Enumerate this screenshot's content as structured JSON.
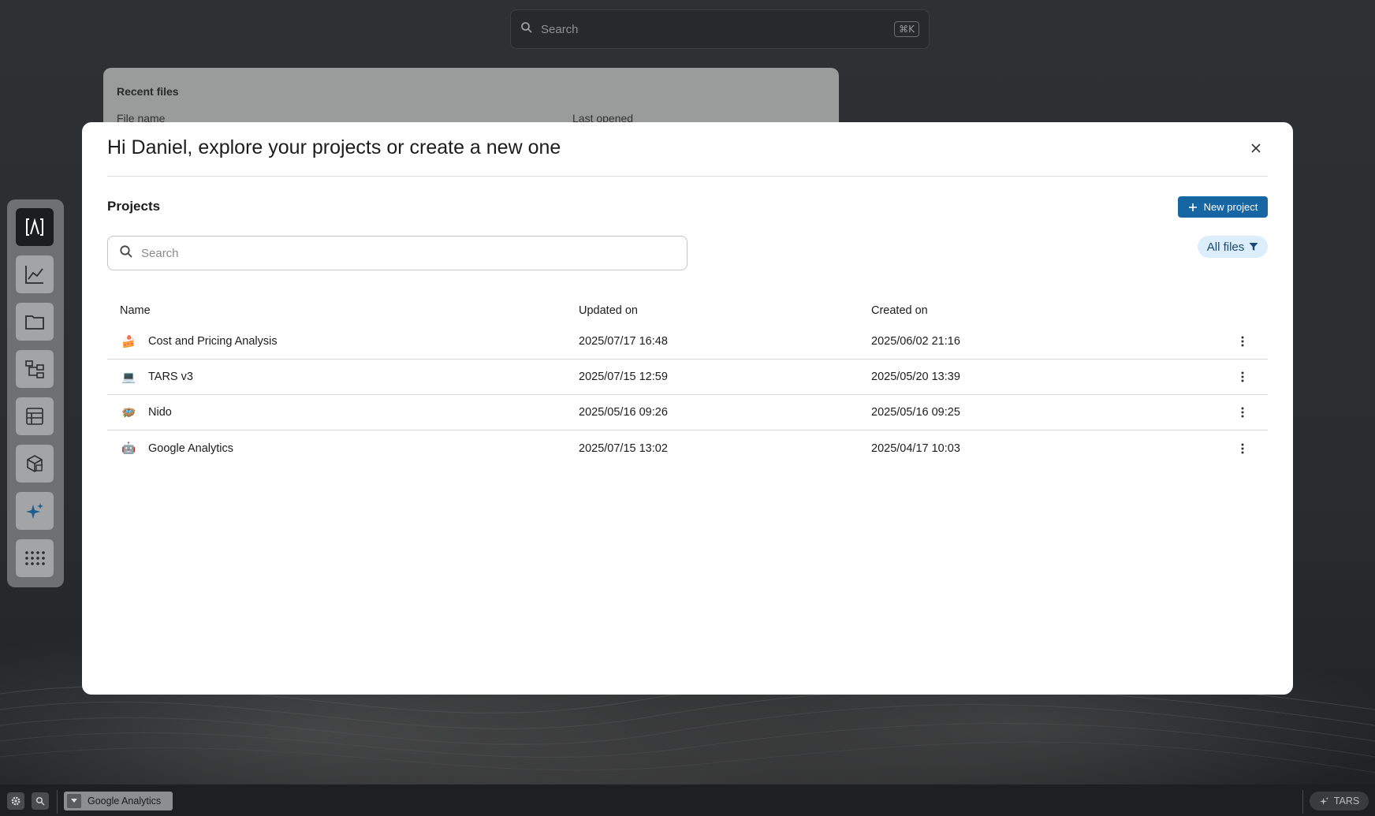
{
  "top_search": {
    "placeholder": "Search",
    "shortcut": "⌘K"
  },
  "recent_files": {
    "title": "Recent files",
    "columns": [
      "File name",
      "Last opened"
    ]
  },
  "dock": {
    "items": [
      "logo-icon",
      "analytics-icon",
      "folder-icon",
      "diagram-icon",
      "table-icon",
      "package-icon",
      "ai-sparkle-icon",
      "apps-grid-icon"
    ]
  },
  "modal": {
    "title": "Hi Daniel, explore your projects or create a new one",
    "section_title": "Projects",
    "new_project_label": "New project",
    "filter_label": "All files",
    "search_placeholder": "Search",
    "columns": {
      "name": "Name",
      "updated": "Updated on",
      "created": "Created on"
    },
    "projects": [
      {
        "icon": "🍰",
        "name": "Cost and Pricing Analysis",
        "updated": "2025/07/17 16:48",
        "created": "2025/06/02 21:16"
      },
      {
        "icon": "💻",
        "name": "TARS v3",
        "updated": "2025/07/15 12:59",
        "created": "2025/05/20 13:39"
      },
      {
        "icon": "🪺",
        "name": "Nido",
        "updated": "2025/05/16 09:26",
        "created": "2025/05/16 09:25"
      },
      {
        "icon": "🤖",
        "name": "Google Analytics",
        "updated": "2025/07/15 13:02",
        "created": "2025/04/17 10:03"
      }
    ]
  },
  "bottom_bar": {
    "active_tab": "Google Analytics",
    "assistant_label": "TARS"
  },
  "colors": {
    "accent": "#1666a4",
    "filter_bg": "#dceefb",
    "modal_bg": "#ffffff",
    "page_bg": "#2b2d2f"
  }
}
